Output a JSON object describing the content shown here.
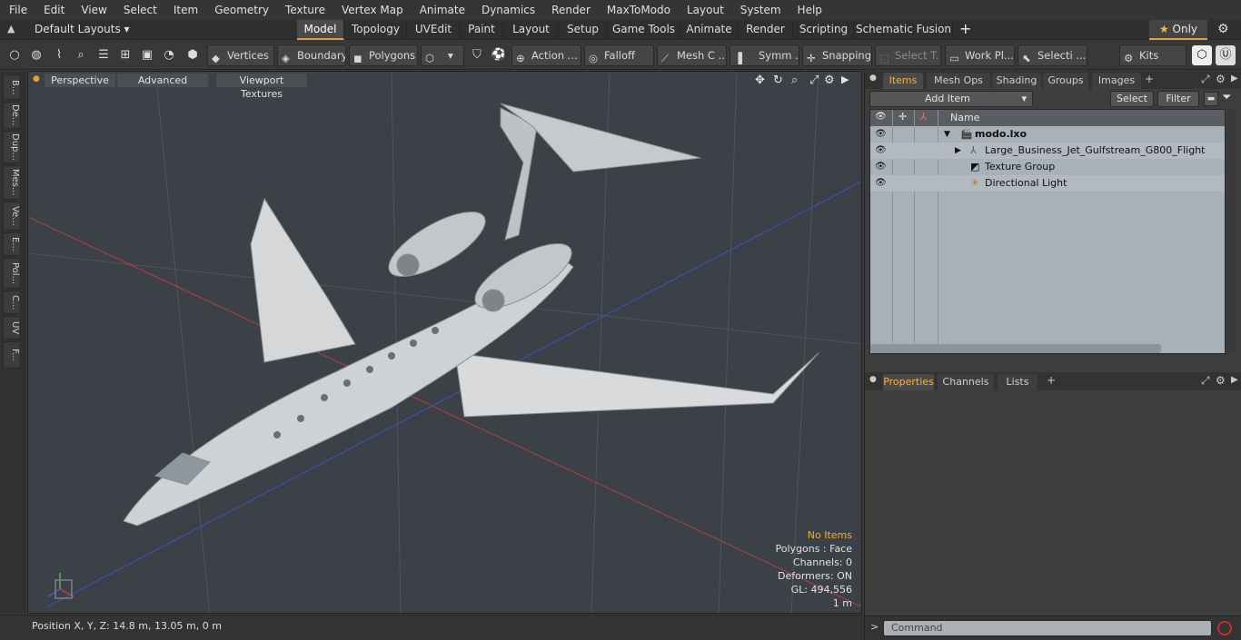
{
  "menu": [
    "File",
    "Edit",
    "View",
    "Select",
    "Item",
    "Geometry",
    "Texture",
    "Vertex Map",
    "Animate",
    "Dynamics",
    "Render",
    "MaxToModo",
    "Layout",
    "System",
    "Help"
  ],
  "layouts": {
    "preset": "Default Layouts",
    "tabs": [
      "Model",
      "Topology",
      "UVEdit",
      "Paint",
      "Layout",
      "Setup",
      "Game Tools",
      "Animate",
      "Render",
      "Scripting",
      "Schematic Fusion"
    ],
    "active": "Model",
    "add": "+",
    "only_label": "Only"
  },
  "toolbar": {
    "vertices": "Vertices",
    "boundary": "Boundary",
    "polygons": "Polygons",
    "action": "Action ...",
    "falloff": "Falloff",
    "mesh": "Mesh C ...",
    "symm": "Symm ...",
    "snapping": "Snapping",
    "select_t": "Select T...",
    "work_pl": "Work Pl...",
    "selecti": "Selecti ...",
    "kits": "Kits"
  },
  "left_tabs": [
    "B...",
    "De...",
    "Dup...",
    "Mes...",
    "Ve...",
    "E...",
    "Pol...",
    "C...",
    "UV",
    "F..."
  ],
  "viewport": {
    "view": "Perspective",
    "shading": "Advanced",
    "textures": "Viewport Textures",
    "stats": {
      "items": "No Items",
      "polygons": "Polygons : Face",
      "channels": "Channels: 0",
      "deformers": "Deformers: ON",
      "gl": "GL: 494,556",
      "scale": "1 m"
    }
  },
  "status": {
    "position": "Position X, Y, Z:   14.8 m, 13.05 m, 0 m"
  },
  "items_panel": {
    "tabs": [
      "Items",
      "Mesh Ops",
      "Shading",
      "Groups",
      "Images"
    ],
    "active": "Items",
    "add_item": "Add Item",
    "select": "Select",
    "filter": "Filter",
    "column_name": "Name",
    "rows": [
      {
        "label": "modo.lxo"
      },
      {
        "label": "Large_Business_Jet_Gulfstream_G800_Flight"
      },
      {
        "label": "Texture Group"
      },
      {
        "label": "Directional Light"
      }
    ]
  },
  "properties_panel": {
    "tabs": [
      "Properties",
      "Channels",
      "Lists"
    ],
    "active": "Properties"
  },
  "command": {
    "placeholder": "Command",
    "prompt": ">"
  }
}
